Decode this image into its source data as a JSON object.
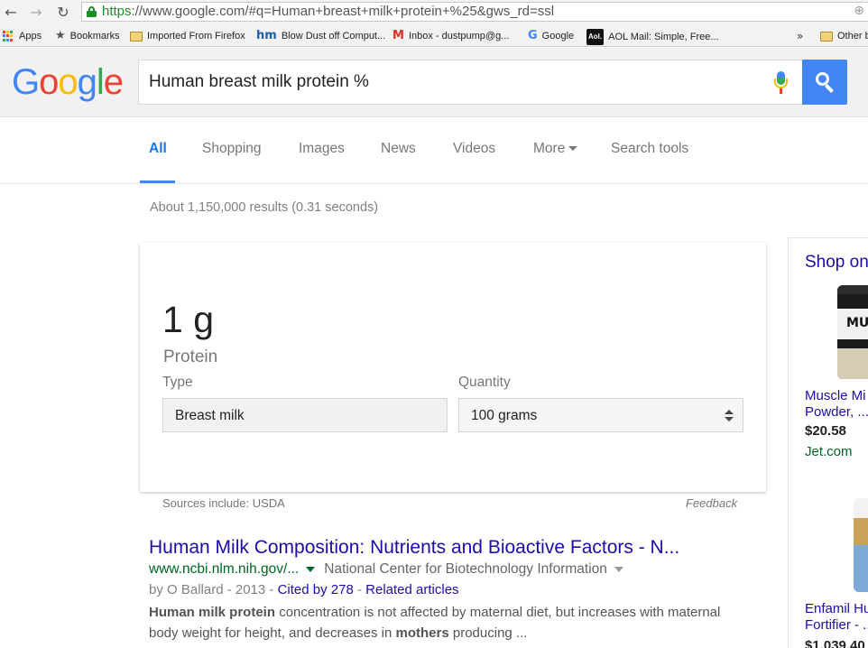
{
  "browser": {
    "url_scheme": "https",
    "url_rest": "://www.google.com/#q=Human+breast+milk+protein+%25&gws_rd=ssl",
    "bookmarks": [
      {
        "label": "Apps",
        "icon": "apps-grid-icon"
      },
      {
        "label": "Bookmarks",
        "icon": "star-icon"
      },
      {
        "label": "Imported From Firefox",
        "icon": "folder-icon"
      },
      {
        "label": "Blow Dust off Comput...",
        "icon": "hm-favicon"
      },
      {
        "label": "Inbox - dustpump@g...",
        "icon": "gmail-icon"
      },
      {
        "label": "Google",
        "icon": "google-favicon"
      },
      {
        "label": "AOL Mail: Simple, Free...",
        "icon": "aol-favicon"
      },
      {
        "label": "Other b",
        "icon": "folder-icon"
      }
    ],
    "overflow_chevron": "»"
  },
  "google": {
    "logo_letters": [
      "G",
      "o",
      "o",
      "g",
      "l",
      "e"
    ],
    "logo_colors": [
      "#4285f4",
      "#ea4335",
      "#fbbc05",
      "#4285f4",
      "#34a853",
      "#ea4335"
    ],
    "query": "Human breast milk protein %",
    "accent": "#4285f4"
  },
  "tabs": [
    {
      "label": "All",
      "active": true
    },
    {
      "label": "Shopping"
    },
    {
      "label": "Images"
    },
    {
      "label": "News"
    },
    {
      "label": "Videos"
    },
    {
      "label": "More"
    },
    {
      "label": "Search tools"
    }
  ],
  "stats": "About 1,150,000 results (0.31 seconds)",
  "answer": {
    "value": "1 g",
    "nutrient": "Protein",
    "type_label": "Type",
    "type_value": "Breast milk",
    "quantity_label": "Quantity",
    "quantity_value": "100 grams",
    "sources": "Sources include: USDA",
    "feedback": "Feedback"
  },
  "result": {
    "title": "Human Milk Composition: Nutrients and Bioactive Factors - N...",
    "cite": "www.ncbi.nlm.nih.gov/...",
    "site_name": "National Center for Biotechnology Information",
    "meta_prefix": "by O Ballard - 2013 - ",
    "cited_by": "Cited by 278",
    "meta_sep": " - ",
    "related": "Related articles",
    "snippet_b1": "Human milk protein",
    "snippet_t1": " concentration is not affected by maternal diet, but increases with maternal body weight for height, and decreases in ",
    "snippet_b2": "mothers",
    "snippet_t2": " producing ..."
  },
  "shopping": {
    "title": "Shop on",
    "products": [
      {
        "name_line1": "Muscle Mi",
        "name_line2": "Powder, ...",
        "price": "$20.58",
        "store": "Jet.com"
      },
      {
        "name_line1": "Enfamil Hu",
        "name_line2": "Fortifier - ...",
        "price": "$1,039.40"
      }
    ],
    "img1_text": "MU"
  }
}
